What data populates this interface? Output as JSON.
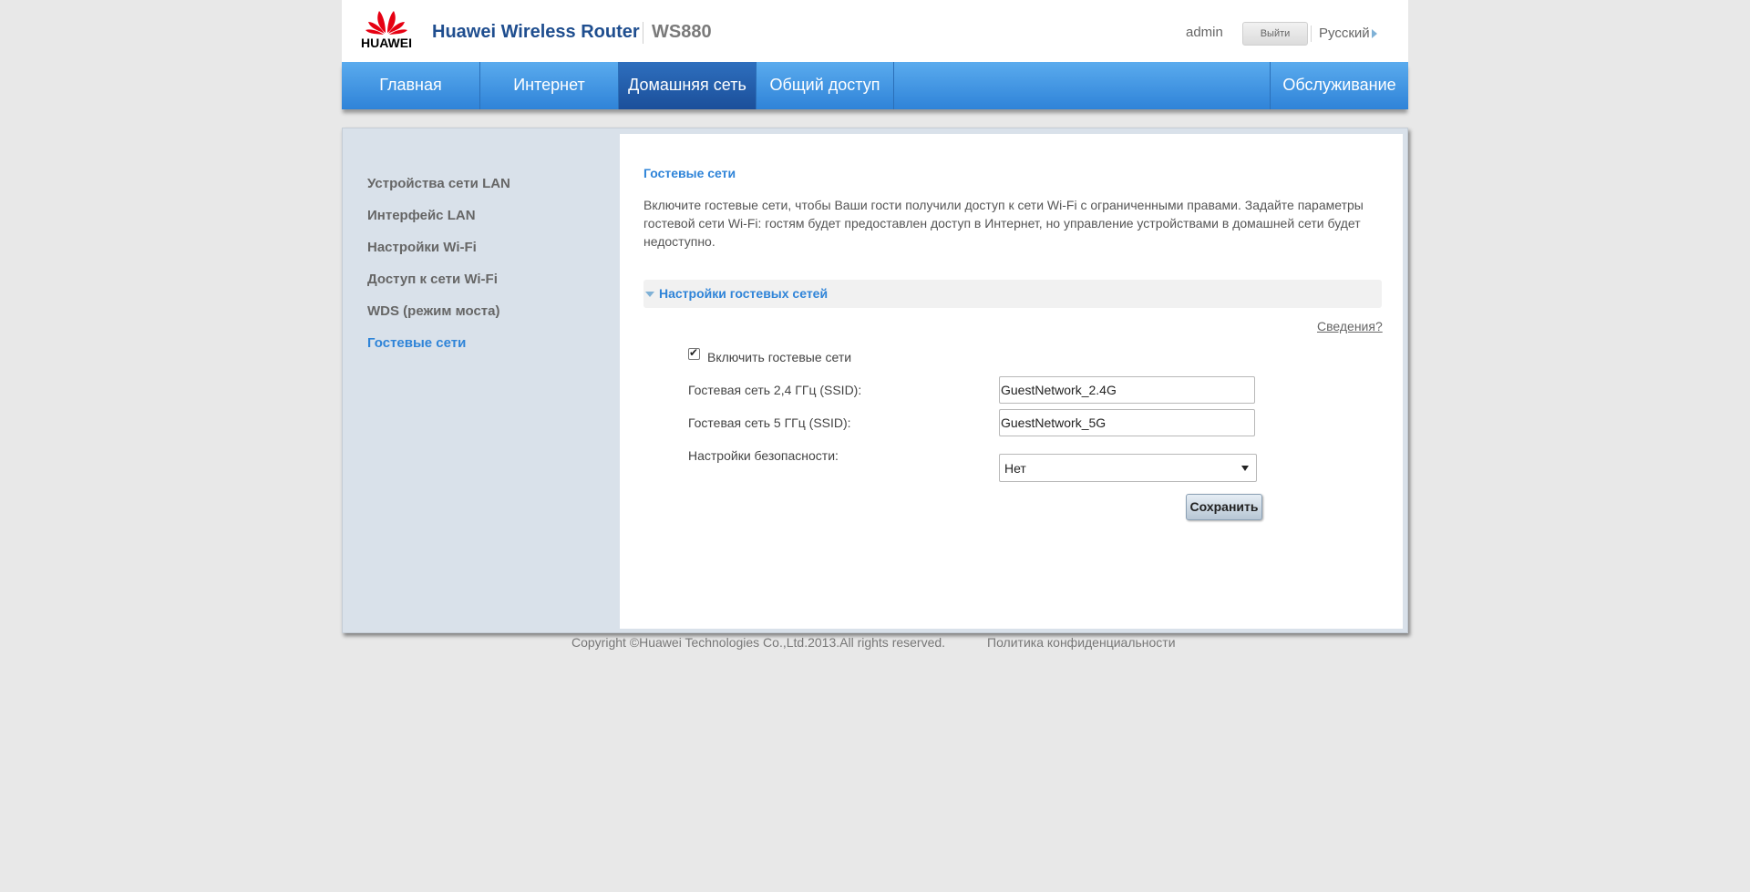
{
  "header": {
    "logo_text": "HUAWEI",
    "product_title": "Huawei Wireless Router",
    "model": "WS880",
    "user": "admin",
    "logout_label": "Выйти",
    "language": "Русский"
  },
  "nav": {
    "items": [
      {
        "label": "Главная"
      },
      {
        "label": "Интернет"
      },
      {
        "label": "Домашняя сеть"
      },
      {
        "label": "Общий доступ"
      },
      {
        "label": "Обслуживание"
      }
    ],
    "active": "Домашняя сеть"
  },
  "sidebar": {
    "items": [
      {
        "label": "Устройства сети LAN"
      },
      {
        "label": "Интерфейс LAN"
      },
      {
        "label": "Настройки Wi-Fi"
      },
      {
        "label": "Доступ к сети Wi-Fi"
      },
      {
        "label": "WDS (режим моста)"
      },
      {
        "label": "Гостевые сети"
      }
    ],
    "active": "Гостевые сети"
  },
  "content": {
    "title": "Гостевые сети",
    "description": "Включите гостевые сети, чтобы Ваши гости получили доступ к сети Wi-Fi с ограниченными правами. Задайте параметры гостевой сети Wi-Fi: гостям будет предоставлен доступ в Интернет, но управление устройствами в домашней сети будет недоступно.",
    "section_title": "Настройки гостевых сетей",
    "help_link": "Сведения?",
    "enable_label": "Включить гостевые сети",
    "enable_checked": true,
    "ssid_24_label": "Гостевая сеть 2,4 ГГц (SSID):",
    "ssid_24_value": "GuestNetwork_2.4G",
    "ssid_5_label": "Гостевая сеть 5 ГГц (SSID):",
    "ssid_5_value": "GuestNetwork_5G",
    "security_label": "Настройки безопасности:",
    "security_value": "Нет",
    "save_label": "Сохранить"
  },
  "footer": {
    "copyright": "Copyright ©Huawei Technologies Co.,Ltd.2013.All rights reserved.",
    "privacy": "Политика конфиденциальности"
  },
  "colors": {
    "accent": "#2f84d8",
    "nav_active": "#1b4f9a",
    "sidebar_bg": "#d9e1ea",
    "brand_red": "#e60012"
  }
}
